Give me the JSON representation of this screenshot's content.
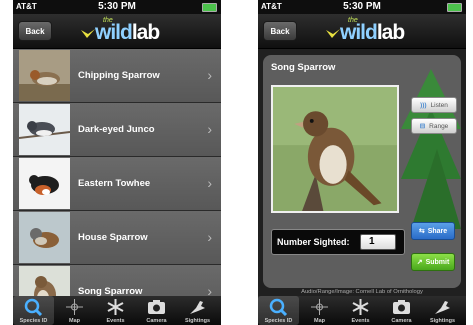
{
  "status": {
    "carrier": "AT&T",
    "time": "5:30 PM"
  },
  "nav": {
    "back_label": "Back",
    "logo_the": "the",
    "logo_wild": "wild",
    "logo_lab": "lab"
  },
  "species_list": [
    {
      "name": "Chipping Sparrow"
    },
    {
      "name": "Dark-eyed Junco"
    },
    {
      "name": "Eastern Towhee"
    },
    {
      "name": "House Sparrow"
    },
    {
      "name": "Song Sparrow"
    }
  ],
  "detail": {
    "species_name": "Song Sparrow",
    "listen_label": "Listen",
    "range_label": "Range",
    "number_sighted_label": "Number Sighted:",
    "number_sighted_value": "1",
    "share_label": "Share",
    "submit_label": "Submit",
    "credit": "Audio/Range/Image: Cornell Lab of Ornithology"
  },
  "tabs": [
    {
      "label": "Species ID",
      "icon": "search-icon",
      "active": true
    },
    {
      "label": "Map",
      "icon": "crosshair-icon",
      "active": false
    },
    {
      "label": "Events",
      "icon": "asterisk-icon",
      "active": false
    },
    {
      "label": "Camera",
      "icon": "camera-icon",
      "active": false
    },
    {
      "label": "Sightings",
      "icon": "bird-icon",
      "active": false
    }
  ],
  "colors": {
    "logo_blue": "#8fd0ff",
    "share_blue": "#2a6cc8",
    "submit_green": "#4aa81c",
    "active_tab": "#4ab0ff"
  }
}
